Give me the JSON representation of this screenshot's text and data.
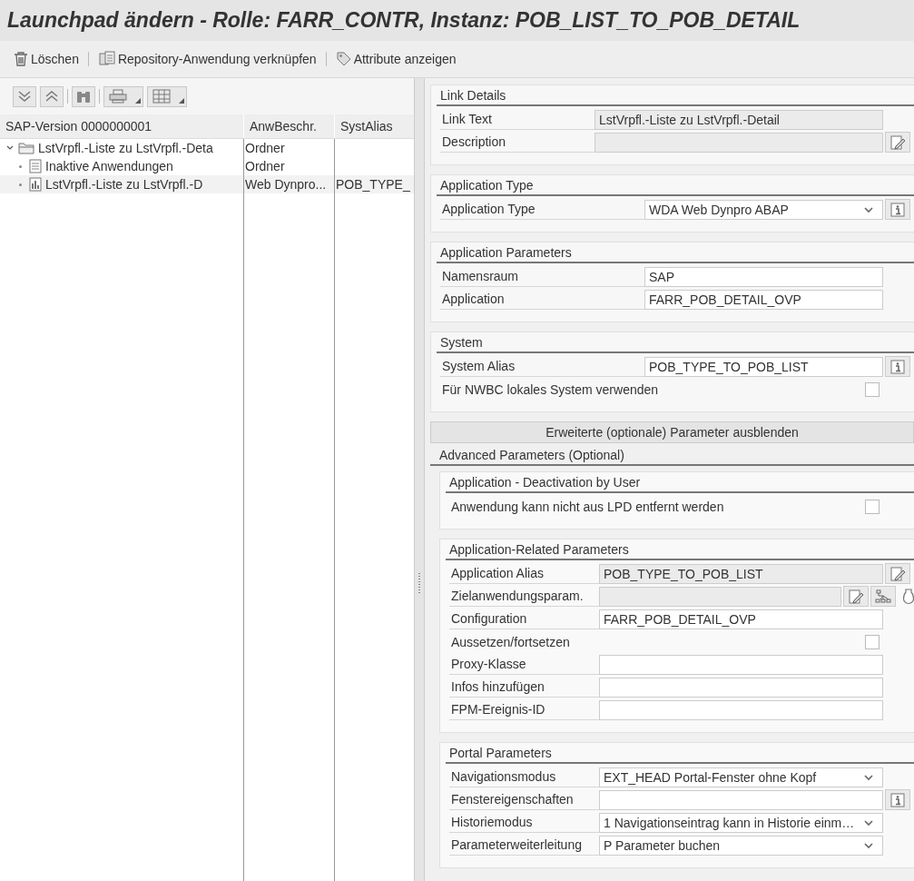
{
  "window": {
    "title": "Launchpad ändern - Rolle: FARR_CONTR, Instanz: POB_LIST_TO_POB_DETAIL"
  },
  "toolbar": [
    {
      "kind": "delete",
      "label": "Löschen"
    },
    {
      "kind": "link",
      "label": "Repository-Anwendung verknüpfen"
    },
    {
      "kind": "tag",
      "label": "Attribute anzeigen"
    }
  ],
  "tree": {
    "columns": [
      "SAP-Version 0000000001",
      "AnwBeschr.",
      "SystAlias"
    ],
    "rows": [
      {
        "kind": "folder",
        "cells": [
          "LstVrpfl.-Liste zu LstVrpfl.-Deta",
          "Ordner"
        ],
        "expanded": true,
        "selected": false,
        "children": [
          {
            "kind": "list",
            "cells": [
              "Inaktive Anwendungen",
              "Ordner"
            ],
            "selected": false
          },
          {
            "kind": "app",
            "cells": [
              "LstVrpfl.-Liste zu LstVrpfl.-D",
              "Web Dynpro...",
              "POB_TYPE_"
            ],
            "selected": true
          }
        ]
      }
    ]
  },
  "sections": [
    {
      "title": "Link Details",
      "rows": [
        {
          "kind": "field",
          "label": "Link Text",
          "value": "LstVrpfl.-Liste zu LstVrpfl.-Detail",
          "disabled": true
        },
        {
          "kind": "field",
          "label": "Description",
          "disabled": true,
          "buttons": [
            {
              "kind": "edit"
            }
          ]
        }
      ]
    },
    {
      "title": "Application Type",
      "rows": [
        {
          "kind": "dropdown",
          "label": "Application Type",
          "value": "WDA Web Dynpro ABAP",
          "buttons": [
            {
              "kind": "info"
            }
          ]
        }
      ]
    },
    {
      "title": "Application Parameters",
      "rows": [
        {
          "kind": "field",
          "label": "Namensraum",
          "value": "SAP",
          "disabled": false
        },
        {
          "kind": "field",
          "label": "Application",
          "value": "FARR_POB_DETAIL_OVP",
          "disabled": false
        }
      ]
    },
    {
      "title": "System",
      "rows": [
        {
          "kind": "field",
          "label": "System Alias",
          "value": "POB_TYPE_TO_POB_LIST",
          "disabled": false,
          "buttons": [
            {
              "kind": "info"
            }
          ]
        },
        {
          "kind": "checkbox",
          "label": "Für NWBC lokales System verwenden",
          "checked": false
        }
      ]
    }
  ],
  "advanced": {
    "toggle": "Erweiterte (optionale) Parameter ausblenden",
    "title": "Advanced Parameters (Optional)",
    "sections": [
      {
        "title": "Application - Deactivation by User",
        "rows": [
          {
            "kind": "checkbox",
            "label": "Anwendung kann nicht aus LPD entfernt werden",
            "checked": false
          }
        ]
      },
      {
        "title": "Application-Related Parameters",
        "rows": [
          {
            "kind": "field",
            "label": "Application Alias",
            "value": "POB_TYPE_TO_POB_LIST",
            "disabled": true,
            "buttons": [
              {
                "kind": "edit"
              }
            ]
          },
          {
            "kind": "field",
            "label": "Zielanwendungsparam.",
            "disabled": true,
            "buttons": [
              {
                "kind": "edit"
              },
              {
                "kind": "mapping"
              },
              {
                "kind": "lamp"
              }
            ]
          },
          {
            "kind": "field",
            "label": "Configuration",
            "value": "FARR_POB_DETAIL_OVP",
            "disabled": false
          },
          {
            "kind": "checkbox",
            "label": "Aussetzen/fortsetzen",
            "checked": false
          },
          {
            "kind": "field",
            "label": "Proxy-Klasse",
            "disabled": false
          },
          {
            "kind": "field",
            "label": "Infos hinzufügen",
            "disabled": false
          },
          {
            "kind": "field",
            "label": "FPM-Ereignis-ID",
            "disabled": false
          }
        ]
      },
      {
        "title": "Portal Parameters",
        "rows": [
          {
            "kind": "dropdown",
            "label": "Navigationsmodus",
            "value": "EXT_HEAD Portal-Fenster ohne Kopf"
          },
          {
            "kind": "field",
            "label": "Fenstereigenschaften",
            "disabled": false,
            "buttons": [
              {
                "kind": "info"
              }
            ]
          },
          {
            "kind": "dropdown",
            "label": "Historiemodus",
            "value": "1 Navigationseintrag kann in Historie einm…"
          },
          {
            "kind": "dropdown",
            "label": "Parameterweiterleitung",
            "value": "P Parameter buchen"
          }
        ]
      }
    ]
  }
}
